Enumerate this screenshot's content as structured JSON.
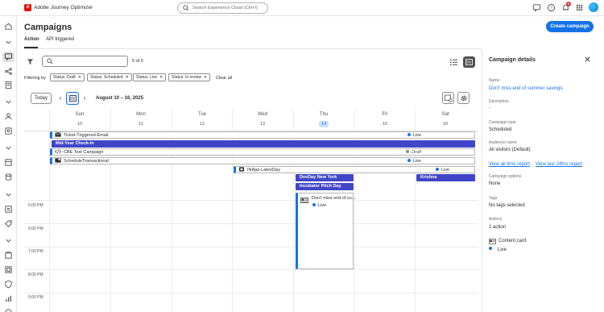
{
  "app": {
    "name": "Adobe Journey Optimizer",
    "logo_letter": "A"
  },
  "topbar": {
    "search_placeholder": "Search Experience Cloud (Ctrl+/)",
    "notification_count": "6"
  },
  "page": {
    "title": "Campaigns",
    "create_button": "Create campaign"
  },
  "tabs": [
    {
      "label": "Action",
      "active": true
    },
    {
      "label": "API triggered",
      "active": false
    }
  ],
  "toolbar": {
    "search_value": "",
    "count": "5 of 5"
  },
  "filters": {
    "label": "Filtering by",
    "chips": [
      "Status: Draft",
      "Status: Scheduled",
      "Status: Live",
      "Status: In review"
    ],
    "clear_all": "Clear all"
  },
  "calendar": {
    "today_label": "Today",
    "range": "August 10 – 16, 2025",
    "days": [
      {
        "name": "Sun",
        "num": "10"
      },
      {
        "name": "Mon",
        "num": "11"
      },
      {
        "name": "Tue",
        "num": "12"
      },
      {
        "name": "Wed",
        "num": "13"
      },
      {
        "name": "Thu",
        "num": "14",
        "today": true
      },
      {
        "name": "Fri",
        "num": "15"
      },
      {
        "name": "Sat",
        "num": "16"
      }
    ],
    "hours": [
      "5:00 PM",
      "6:00 PM",
      "7:00 PM",
      "8:00 PM",
      "9:00 PM"
    ],
    "events": [
      {
        "name": "Ticket-Triggered-Email",
        "status": "Live",
        "icon": "email-icon"
      },
      {
        "name": "Mid-Year Check-In",
        "status": "",
        "icon": ""
      },
      {
        "name": "CBE Test Campaign",
        "status": "Draft",
        "icon": "code-icon"
      },
      {
        "name": "ScheduleTransactional",
        "status": "Live",
        "icon": "transactional-icon"
      },
      {
        "name": "INApp-LaborDay",
        "status": "Live",
        "icon": "in-app-icon"
      },
      {
        "name": "Krishna",
        "status": "",
        "icon": ""
      },
      {
        "name": "DevDay New York",
        "status": "",
        "icon": ""
      },
      {
        "name": "Incubator Pitch Day",
        "status": "",
        "icon": ""
      },
      {
        "name": "Don't miss end of su…",
        "status": "Live",
        "icon": "content-card-icon"
      }
    ]
  },
  "details": {
    "title": "Campaign details",
    "name_label": "Name",
    "name_value": "Don't miss end of summer savings",
    "description_label": "Description",
    "description_value": "-",
    "type_label": "Campaign type",
    "type_value": "Scheduled",
    "audience_label": "Audience name",
    "audience_value": "All visitors (Default)",
    "link_all_time": "View all time report",
    "link_24h": "View last 24hrs report",
    "options_label": "Campaign options",
    "options_value": "None",
    "tags_label": "Tags",
    "tags_value": "No tags selected",
    "actions_label": "Actions",
    "actions_value": "1 action",
    "action_channel": "Content card",
    "action_status": "Live"
  },
  "colors": {
    "accent": "#1473e6",
    "event_solid": "#4146c8",
    "brand": "#eb1000"
  }
}
